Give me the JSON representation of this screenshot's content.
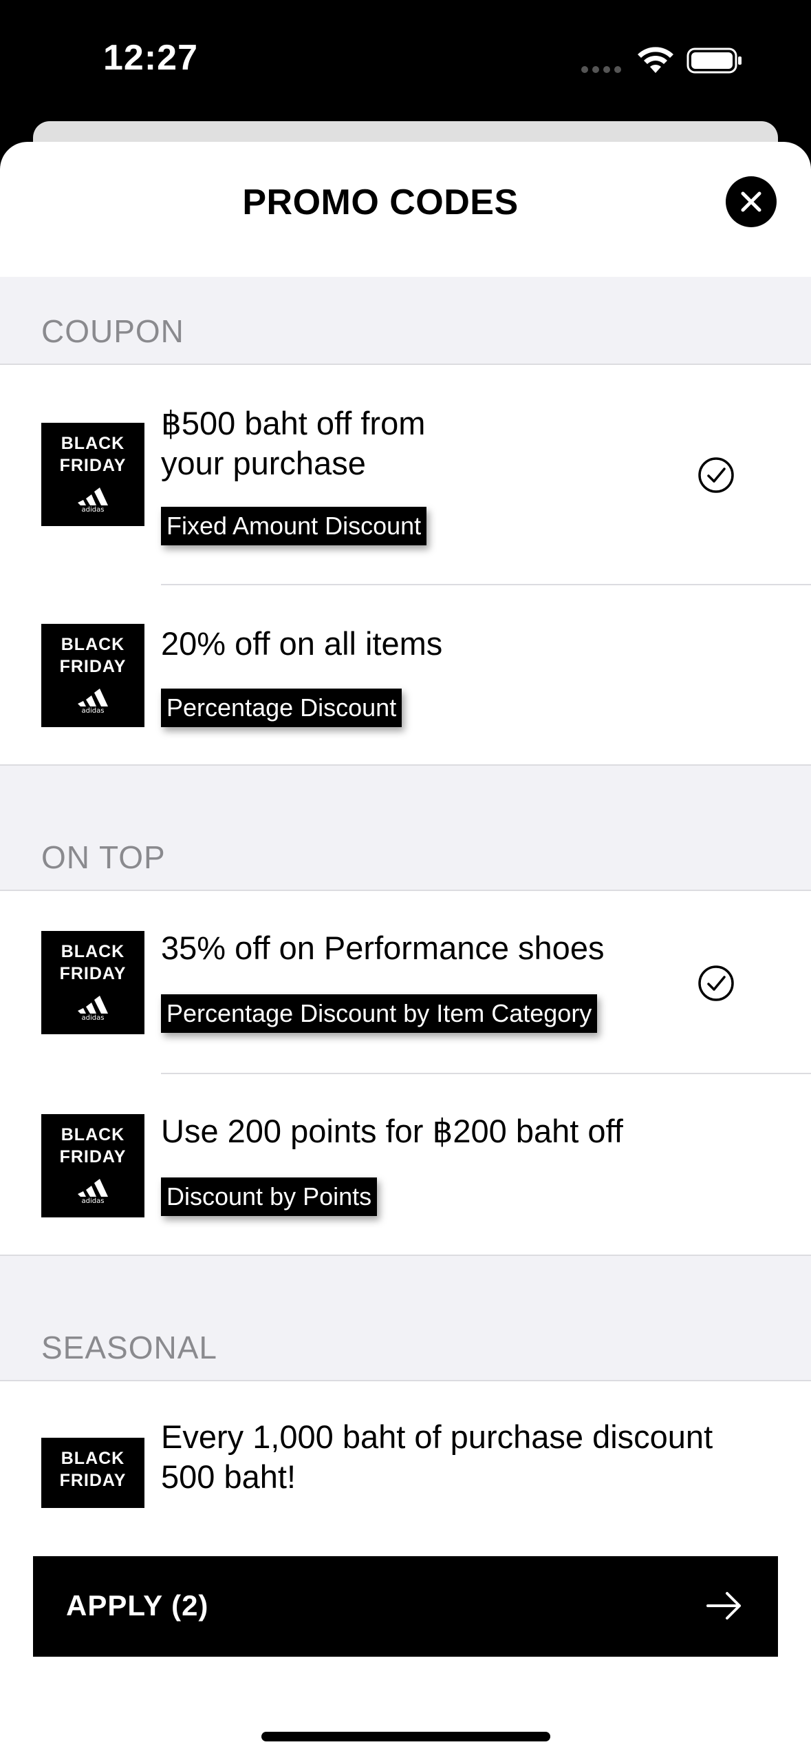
{
  "status_bar": {
    "time": "12:27"
  },
  "sheet": {
    "title": "PROMO CODES"
  },
  "promo_logo": {
    "line1": "BLACK",
    "line2": "FRIDAY",
    "brand": "adidas"
  },
  "sections": {
    "coupon": {
      "header": "COUPON",
      "items": [
        {
          "title_line1": "฿500 baht off from",
          "title_line2": "your purchase",
          "tag": "Fixed Amount Discount",
          "selected": true
        },
        {
          "title_line1": "20% off on all items",
          "tag": "Percentage Discount",
          "selected": false
        }
      ]
    },
    "on_top": {
      "header": "ON TOP",
      "items": [
        {
          "title_line1": "35% off on Performance shoes",
          "tag": "Percentage Discount by Item Category",
          "selected": true
        },
        {
          "title_line1": "Use 200 points for ฿200 baht off",
          "tag": "Discount by Points",
          "selected": false
        }
      ]
    },
    "seasonal": {
      "header": "SEASONAL",
      "items": [
        {
          "title_line1": "Every 1,000 baht of purchase discount",
          "title_line2": "500 baht!"
        }
      ]
    }
  },
  "apply_button": {
    "label": "APPLY (2)"
  },
  "icons": {
    "close": "close-icon",
    "check": "check-circle-icon",
    "arrow": "arrow-right-icon",
    "wifi": "wifi-icon",
    "battery": "battery-icon"
  }
}
